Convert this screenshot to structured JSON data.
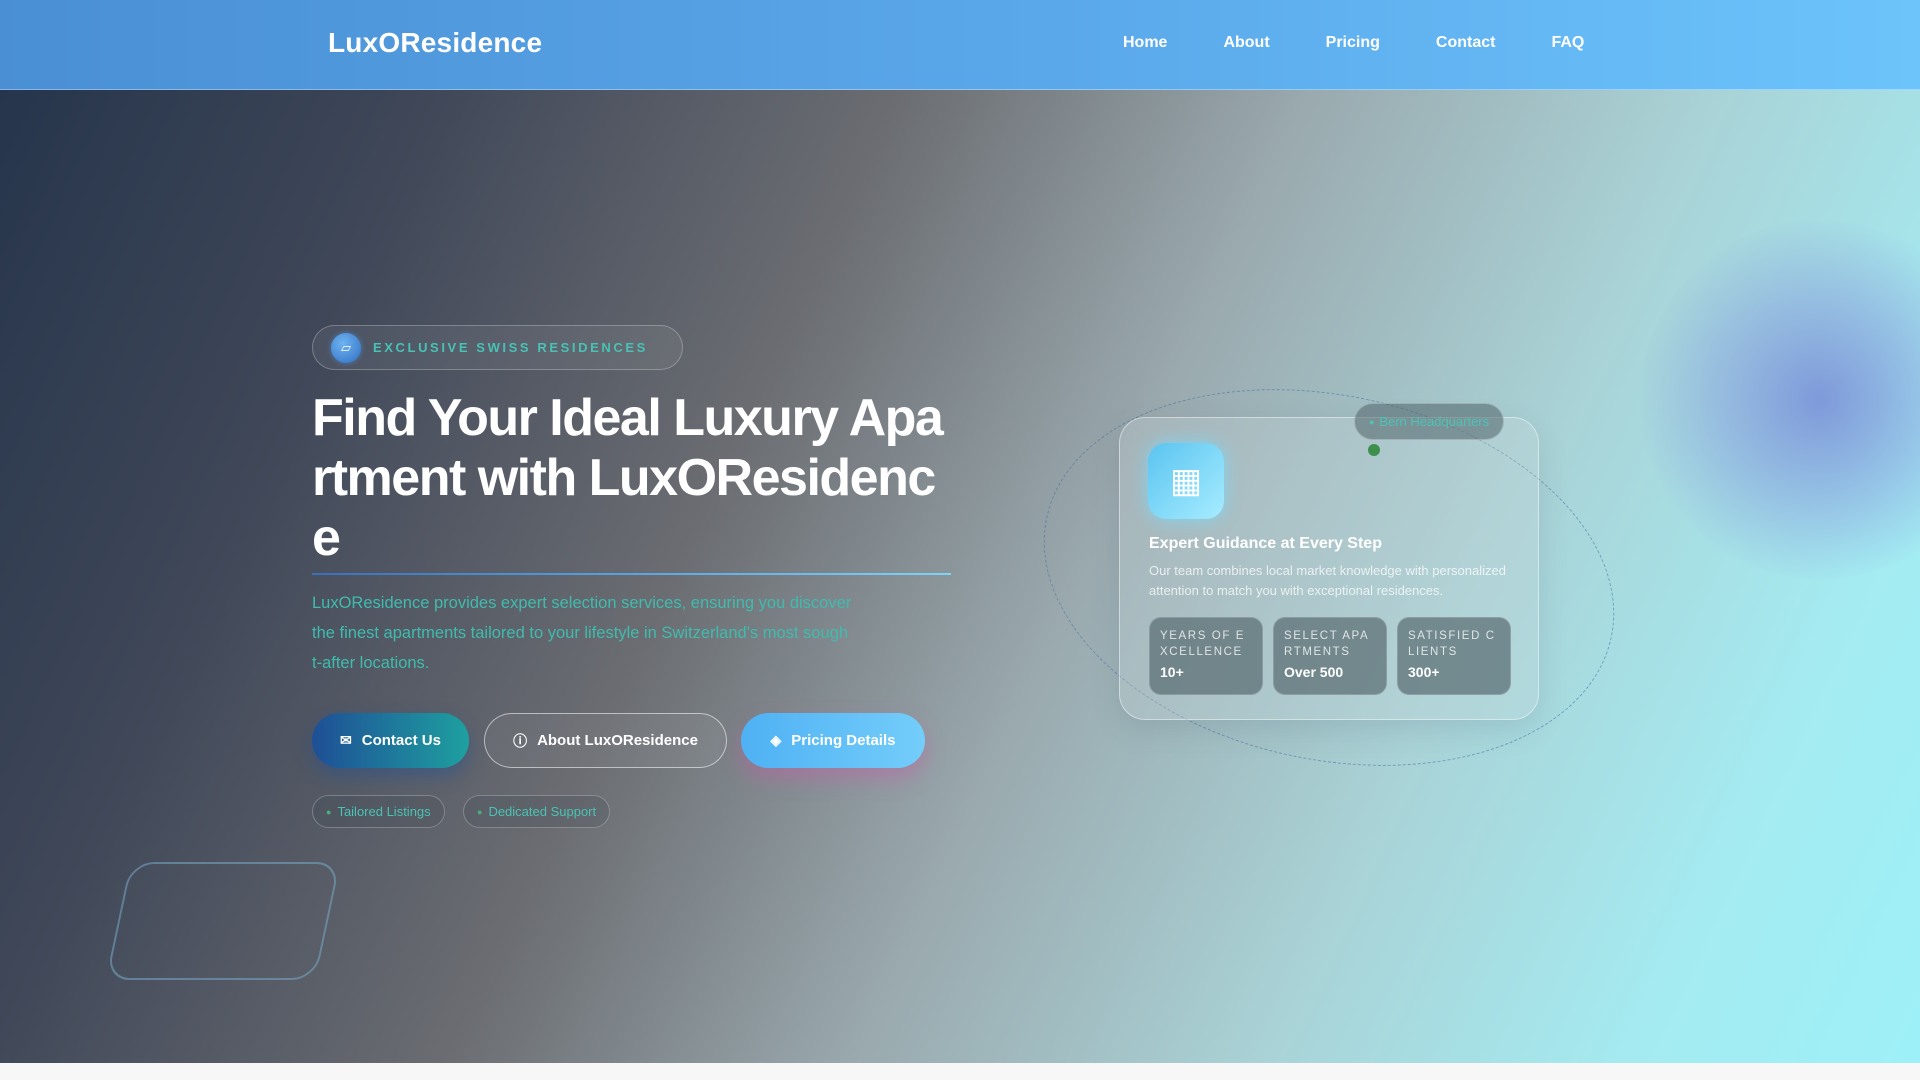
{
  "navbar": {
    "logo": "LuxOResidence",
    "links": [
      "Home",
      "About",
      "Pricing",
      "Contact",
      "FAQ"
    ]
  },
  "hero": {
    "badge_icon": "tag-icon",
    "badge_text": "EXCLUSIVE SWISS RESIDENCES",
    "title": "Find Your Ideal Luxury Apartment with LuxOResidence",
    "description": "LuxOResidence provides expert selection services, ensuring you discover the finest apartments tailored to your lifestyle in Switzerland's most sought-after locations.",
    "buttons": {
      "contact": "Contact Us",
      "about": "About LuxOResidence",
      "pricing": "Pricing Details"
    },
    "tags": [
      "Tailored Listings",
      "Dedicated Support"
    ]
  },
  "card": {
    "location": "Bern Headquarters",
    "title": "Expert Guidance at Every Step",
    "description": "Our team combines local market knowledge with personalized attention to match you with exceptional residences.",
    "stats": [
      {
        "label": "YEARS OF EXCELLENCE",
        "value": "10+"
      },
      {
        "label": "SELECT APARTMENTS",
        "value": "Over 500"
      },
      {
        "label": "SATISFIED CLIENTS",
        "value": "300+"
      }
    ]
  },
  "colors": {
    "nav_start": "#4a8fd4",
    "nav_end": "#6cc4fb",
    "accent_teal": "#48c2b5",
    "hero_dark": "#26354c",
    "hero_light": "#9ef0f8"
  }
}
